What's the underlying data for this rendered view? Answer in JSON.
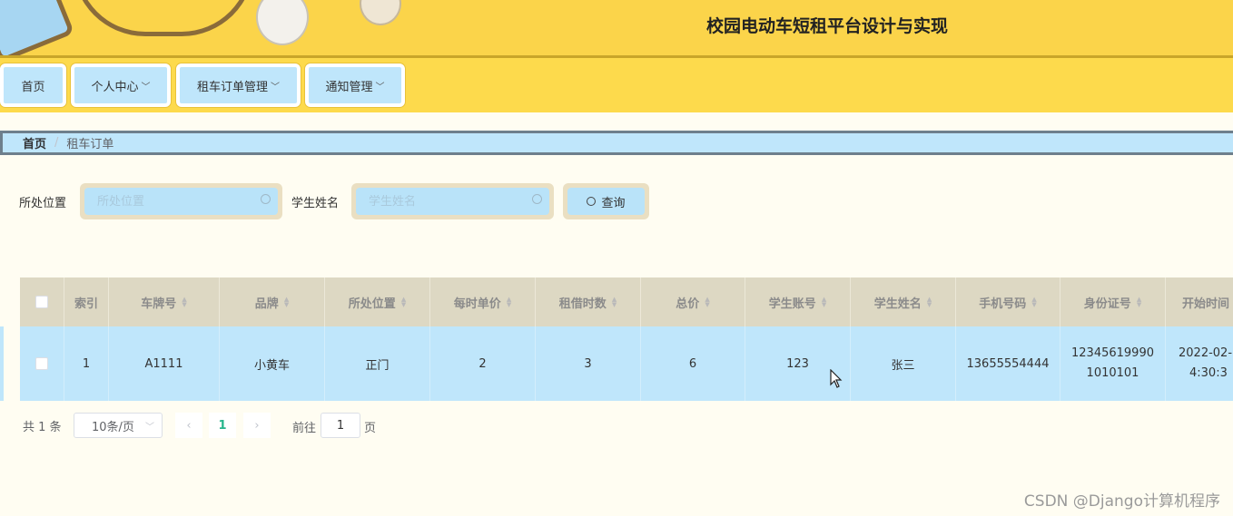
{
  "header": {
    "title": "校园电动车短租平台设计与实现"
  },
  "nav": {
    "items": [
      {
        "label": "首页",
        "has_dropdown": false
      },
      {
        "label": "个人中心",
        "has_dropdown": true
      },
      {
        "label": "租车订单管理",
        "has_dropdown": true
      },
      {
        "label": "通知管理",
        "has_dropdown": true
      }
    ],
    "chevron_icon": "chevron-down-icon"
  },
  "breadcrumb": {
    "home": "首页",
    "separator": "/",
    "current": "租车订单"
  },
  "search": {
    "location_label": "所处位置",
    "location_placeholder": "所处位置",
    "location_value": "",
    "student_label": "学生姓名",
    "student_placeholder": "学生姓名",
    "student_value": "",
    "button_label": "查询",
    "icon": "search-icon"
  },
  "table": {
    "columns": [
      "索引",
      "车牌号",
      "品牌",
      "所处位置",
      "每时单价",
      "租借时数",
      "总价",
      "学生账号",
      "学生姓名",
      "手机号码",
      "身份证号",
      "开始时间"
    ],
    "rows": [
      {
        "index": "1",
        "plate": "A1111",
        "brand": "小黄车",
        "location": "正门",
        "hourly_price": "2",
        "hours": "3",
        "total": "6",
        "student_account": "123",
        "student_name": "张三",
        "phone": "13655554444",
        "id_line1": "12345619990",
        "id_line2": "1010101",
        "start_line1": "2022-02-",
        "start_line2": "4:30:3"
      }
    ]
  },
  "pagination": {
    "total": "共 1 条",
    "page_size": "10条/页",
    "prev": "‹",
    "current_page": "1",
    "next": "›",
    "goto_label": "前往",
    "goto_value": "1",
    "goto_suffix": "页"
  },
  "watermark": "CSDN @Django计算机程序",
  "colors": {
    "header_bg": "#fbd44a",
    "nav_bg": "#fdda4c",
    "accent_blue": "#bfe6fb",
    "table_head_bg": "#ddd8c3",
    "page_bg": "#fffdf2",
    "active_page": "#27b58c"
  }
}
